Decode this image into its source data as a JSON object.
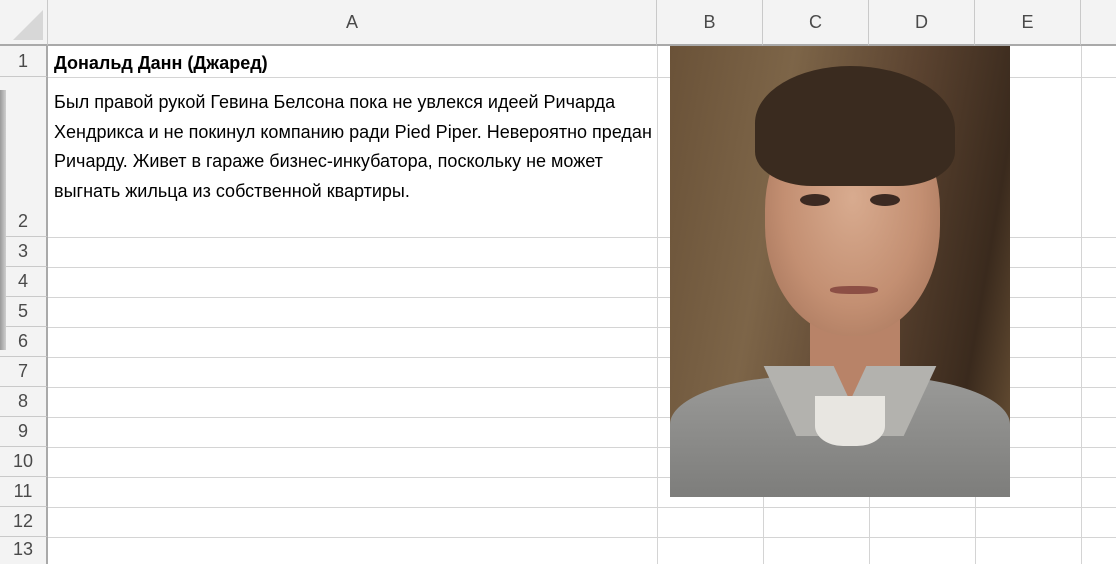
{
  "columns": [
    "A",
    "B",
    "C",
    "D",
    "E"
  ],
  "rows": [
    "1",
    "2",
    "3",
    "4",
    "5",
    "6",
    "7",
    "8",
    "9",
    "10",
    "11",
    "12",
    "13"
  ],
  "cells": {
    "A1": "Дональд Данн (Джаред)",
    "A2": "Был правой рукой Гевина Белсона пока не увлекся идеей Ричарда Хендрикса и не покинул компанию ради Pied Piper. Невероятно предан Ричарду. Живет в гараже бизнес-инкубатора, поскольку не может выгнать жильца из собственной квартиры."
  },
  "image": {
    "description_icon": "portrait-photo"
  },
  "colors": {
    "header_bg": "#f3f3f3",
    "grid_line": "#d4d4d4",
    "header_border": "#a9a9a9"
  }
}
